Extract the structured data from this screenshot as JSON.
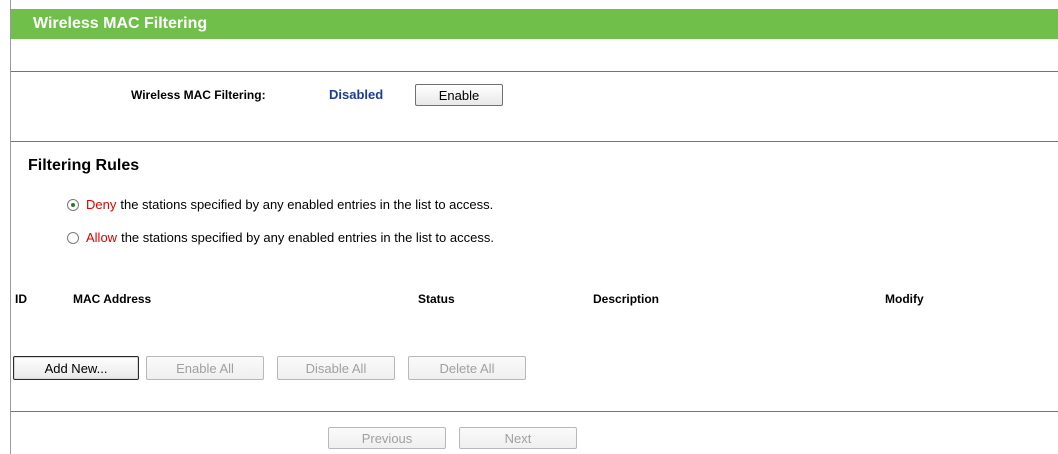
{
  "page": {
    "title": "Wireless MAC Filtering"
  },
  "mac_filtering": {
    "label": "Wireless MAC Filtering:",
    "status": "Disabled",
    "enable_button": "Enable"
  },
  "filtering_rules": {
    "heading": "Filtering Rules",
    "options": [
      {
        "keyword": "Deny",
        "text": "the stations specified by any enabled entries in the list to access.",
        "selected": true
      },
      {
        "keyword": "Allow",
        "text": "the stations specified by any enabled entries in the list to access.",
        "selected": false
      }
    ]
  },
  "table": {
    "columns": [
      "ID",
      "MAC Address",
      "Status",
      "Description",
      "Modify"
    ],
    "rows": []
  },
  "actions": {
    "add_new": "Add New...",
    "enable_all": "Enable All",
    "disable_all": "Disable All",
    "delete_all": "Delete All"
  },
  "pagination": {
    "previous": "Previous",
    "next": "Next"
  },
  "colors": {
    "title_bar": "#6fbf4a",
    "divider": "#3f9b35",
    "status_text": "#1b3d9a",
    "keyword_text": "#e00000"
  }
}
